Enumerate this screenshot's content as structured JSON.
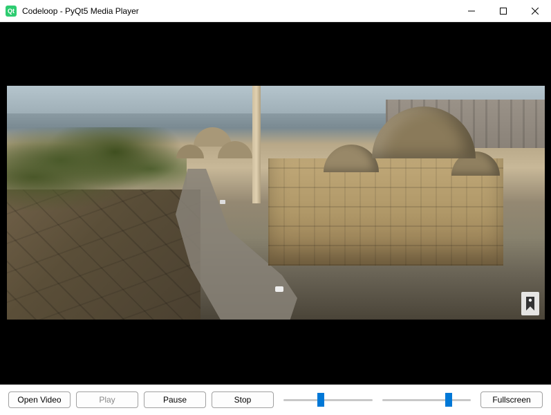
{
  "window": {
    "title": "Codeloop - PyQt5 Media Player",
    "icon_label": "Qt"
  },
  "controls": {
    "open_video_label": "Open Video",
    "play_label": "Play",
    "pause_label": "Pause",
    "stop_label": "Stop",
    "fullscreen_label": "Fullscreen",
    "play_disabled": true,
    "position_slider": {
      "value": 42,
      "min": 0,
      "max": 100
    },
    "volume_slider": {
      "value": 75,
      "min": 0,
      "max": 100
    }
  }
}
